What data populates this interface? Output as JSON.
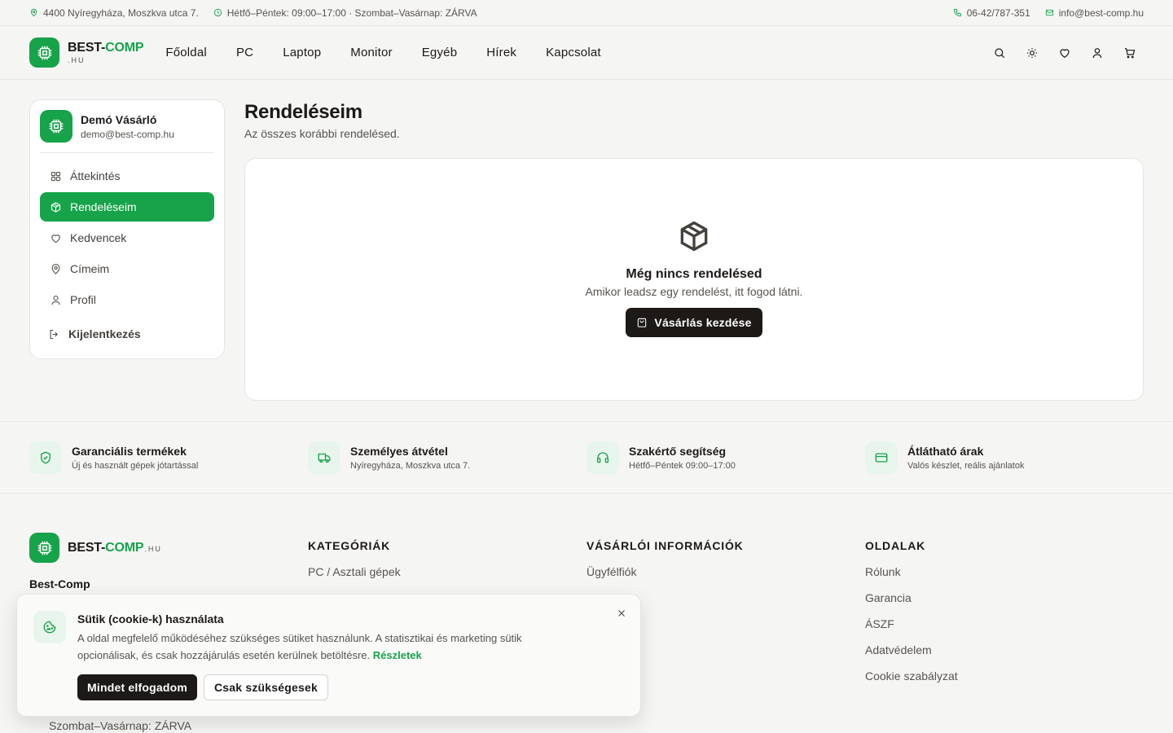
{
  "topbar": {
    "address": "4400 Nyíregyháza, Moszkva utca 7.",
    "hours": "Hétfő–Péntek: 09:00–17:00 · Szombat–Vasárnap: ZÁRVA",
    "phone": "06-42/787-351",
    "email": "info@best-comp.hu"
  },
  "brand": {
    "main": "BEST-",
    "accent": "COMP",
    "sub": ".HU",
    "accent_color": "#16a34a"
  },
  "nav": [
    {
      "label": "Főoldal"
    },
    {
      "label": "PC"
    },
    {
      "label": "Laptop"
    },
    {
      "label": "Monitor"
    },
    {
      "label": "Egyéb"
    },
    {
      "label": "Hírek"
    },
    {
      "label": "Kapcsolat"
    }
  ],
  "header_icons": [
    "search-icon",
    "sun-icon",
    "heart-icon",
    "user-icon",
    "cart-icon"
  ],
  "account": {
    "name": "Demó Vásárló",
    "email": "demo@best-comp.hu",
    "menu": [
      {
        "label": "Áttekintés",
        "icon": "grid-icon"
      },
      {
        "label": "Rendeléseim",
        "icon": "box-icon",
        "active": true
      },
      {
        "label": "Kedvencek",
        "icon": "heart-icon"
      },
      {
        "label": "Címeim",
        "icon": "map-pin-icon"
      },
      {
        "label": "Profil",
        "icon": "user-icon"
      }
    ],
    "logout": "Kijelentkezés"
  },
  "page": {
    "title": "Rendeléseim",
    "subtitle": "Az összes korábbi rendelésed.",
    "empty_title": "Még nincs rendelésed",
    "empty_text": "Amikor leadsz egy rendelést, itt fogod látni.",
    "cta": "Vásárlás kezdése"
  },
  "features": [
    {
      "title": "Garanciális termékek",
      "sub": "Új és használt gépek jótartással",
      "icon": "shield-check-icon"
    },
    {
      "title": "Személyes átvétel",
      "sub": "Nyíregyháza, Moszkva utca 7.",
      "icon": "truck-icon"
    },
    {
      "title": "Szakértő segítség",
      "sub": "Hétfő–Péntek 09:00–17:00",
      "icon": "headphones-icon"
    },
    {
      "title": "Átlátható árak",
      "sub": "Valós készlet, reális ajánlatok",
      "icon": "credit-card-icon"
    }
  ],
  "footer": {
    "brand_name": "Best-Comp",
    "hours_tail": "Szombat–Vasárnap: ZÁRVA",
    "columns": [
      {
        "heading": "KATEGÓRIÁK",
        "links": [
          "PC / Asztali gépek"
        ]
      },
      {
        "heading": "VÁSÁRLÓI INFORMÁCIÓK",
        "links": [
          "Ügyfélfiók"
        ]
      },
      {
        "heading": "OLDALAK",
        "links": [
          "Rólunk",
          "Garancia",
          "ÁSZF",
          "Adatvédelem",
          "Cookie szabályzat"
        ]
      }
    ]
  },
  "cookie": {
    "title": "Sütik (cookie-k) használata",
    "text": "A oldal megfelelő működéséhez szükséges sütiket használunk. A statisztikai és marketing sütik opcionálisak, és csak hozzájárulás esetén kerülnek betöltésre.",
    "link": "Részletek",
    "accept_all": "Mindet elfogadom",
    "necessary_only": "Csak szükségesek"
  }
}
